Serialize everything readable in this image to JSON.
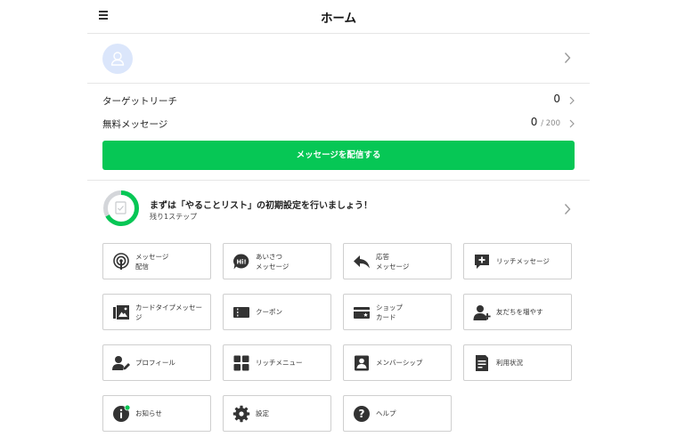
{
  "header": {
    "title": "ホーム"
  },
  "stats": {
    "target_reach": {
      "label": "ターゲットリーチ",
      "value": "0"
    },
    "free_messages": {
      "label": "無料メッセージ",
      "value": "0",
      "limit": "/ 200"
    }
  },
  "cta": {
    "label": "メッセージを配信する"
  },
  "todo": {
    "title": "まずは「やることリスト」の初期設定を行いましょう！",
    "subtitle": "残り1ステップ",
    "progress": 0.67
  },
  "tiles": [
    {
      "label": "メッセージ\n配信",
      "icon": "broadcast-icon"
    },
    {
      "label": "あいさつ\nメッセージ",
      "icon": "greeting-hi-icon"
    },
    {
      "label": "応答\nメッセージ",
      "icon": "reply-icon"
    },
    {
      "label": "リッチメッセージ",
      "icon": "rich-message-icon"
    },
    {
      "label": "カードタイプメッセー\nジ",
      "icon": "card-message-icon"
    },
    {
      "label": "クーポン",
      "icon": "coupon-icon"
    },
    {
      "label": "ショップ\nカード",
      "icon": "shop-card-icon"
    },
    {
      "label": "友だちを増やす",
      "icon": "add-friend-icon"
    },
    {
      "label": "プロフィール",
      "icon": "profile-edit-icon"
    },
    {
      "label": "リッチメニュー",
      "icon": "rich-menu-icon"
    },
    {
      "label": "メンバーシップ",
      "icon": "membership-icon"
    },
    {
      "label": "利用状況",
      "icon": "usage-report-icon"
    },
    {
      "label": "お知らせ",
      "icon": "info-notice-icon"
    },
    {
      "label": "設定",
      "icon": "gear-icon"
    },
    {
      "label": "ヘルプ",
      "icon": "help-icon"
    }
  ],
  "colors": {
    "accent": "#06c755",
    "icon": "#333333",
    "avatar_bg": "#dbe6fb",
    "notice_dot": "#06c755"
  }
}
